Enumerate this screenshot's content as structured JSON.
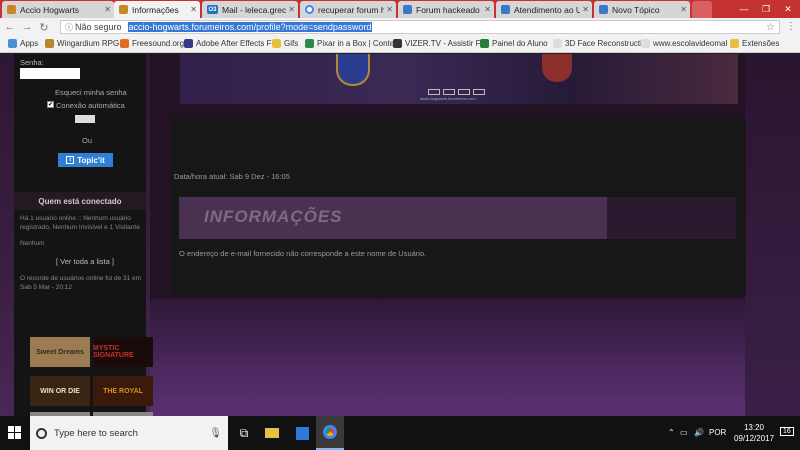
{
  "browser": {
    "tabs": [
      {
        "label": "Accio Hogwarts",
        "color": "#c8882a"
      },
      {
        "label": "Informações",
        "color": "#c8882a"
      },
      {
        "label": "Mail - leleca.greco@",
        "color": "#1f6fc5",
        "badge": "O3"
      },
      {
        "label": "recuperar forum ha",
        "color": "#4285f4"
      },
      {
        "label": "Forum hackeado",
        "color": "#3a79c8"
      },
      {
        "label": "Atendimento ao U",
        "color": "#3a79c8"
      },
      {
        "label": "Novo Tópico",
        "color": "#3a79c8"
      }
    ],
    "security_label": "Não seguro",
    "url": "accio-hogwarts.forumeiros.com/profile?mode=sendpassword",
    "bookmarks": [
      "Apps",
      "Wingardium RPG",
      "Freesound.org",
      "Adobe After Effects F",
      "Gifs",
      "Pixar in a Box | Conte",
      "VIZER.TV - Assistir Fil",
      "Painel do Aluno",
      "3D Face Reconstructi",
      "www.escolavideomal",
      "Extensões"
    ]
  },
  "sidebar": {
    "password_label": "Senha:",
    "forgot_password": "Esqueci minha senha",
    "auto_login_label": "Conexão automática",
    "or_label": "Ou",
    "topicit_label": "Topic'it",
    "who_online_title": "Quem está conectado",
    "online_text": "Há 1 usuário online :: Nenhum usuário registrado, Nenhum Invisível e 1 Visitante",
    "none_text": "Nenhum",
    "view_list": "[ Ver toda a lista ]",
    "record_text": "O recorde de usuários online foi de 31 em Sab 5 Mar - 20:12",
    "thumbnails": [
      "Sweet Dreams",
      "MYSTIC SIGNATURE",
      "WIN OR DIE",
      "THE ROYAL"
    ]
  },
  "main": {
    "banner_caption": "accio-hogwarts.forumeiros.com",
    "datetime": "Data/hora atual: Sab 9 Dez - 16:05",
    "info_title": "INFORMAÇÕES",
    "info_message": "O endereço de e-mail fornecido não corresponde a este nome de Usuário."
  },
  "taskbar": {
    "search_placeholder": "Type here to search",
    "language": "POR",
    "time": "13:20",
    "date": "09/12/2017",
    "notification_count": "16"
  }
}
